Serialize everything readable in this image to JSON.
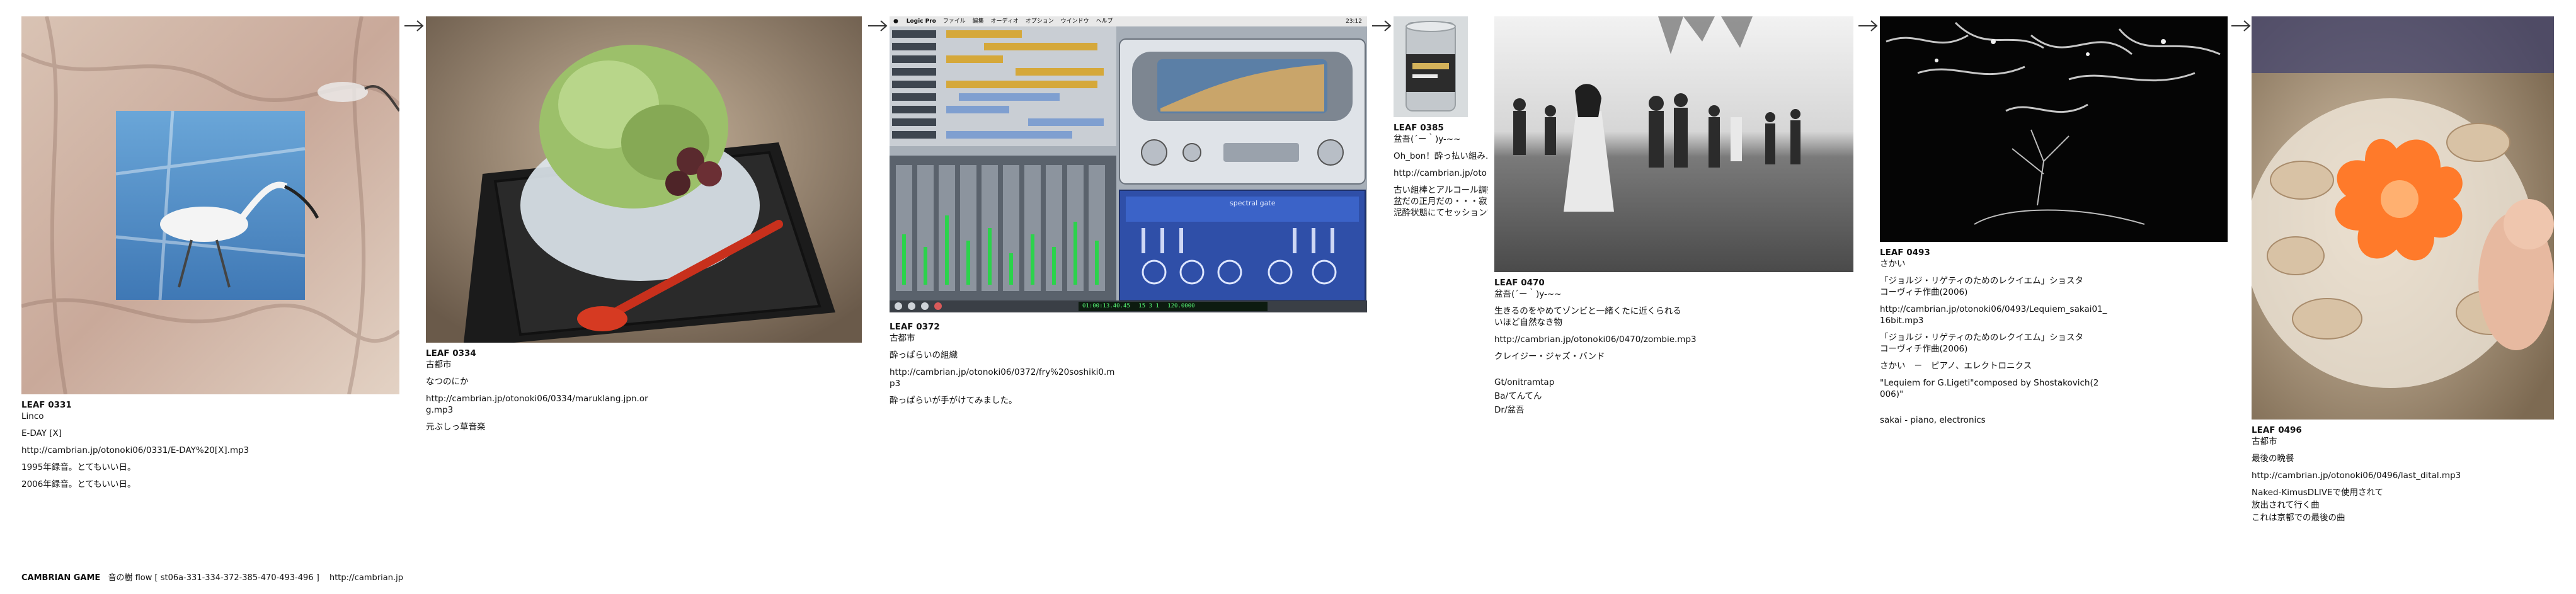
{
  "leaves": [
    {
      "id": "LEAF 0331",
      "lines": [
        "Linco",
        "E-DAY [X]",
        "http://cambrian.jp/otonoki06/0331/E-DAY%20[X].mp3",
        "1995年録音。とてもいい日。",
        "2006年録音。とてもいい日。"
      ]
    },
    {
      "id": "LEAF 0334",
      "lines": [
        "古都市",
        "なつのにか",
        "http://cambrian.jp/otonoki06/0334/maruklang.jpn.or",
        "g.mp3",
        "元ぶしっ草音楽"
      ]
    },
    {
      "id": "LEAF 0372",
      "lines": [
        "古都市",
        "酔っぱらいの組織",
        "http://cambrian.jp/otonoki06/0372/fry%20soshiki0.m",
        "p3",
        "酔っぱらいが手がけてみました。"
      ]
    },
    {
      "id": "LEAF 0385",
      "lines": [
        "盆吾(´ー｀)y-~~",
        "Oh_bon！酔っ払い組み…",
        "http://cambrian.jp/oto",
        "古い組棒とアルコール調整…",
        "盆だの正月だの・・・寂しくて",
        "泥酔状態にてセッションで…"
      ]
    },
    {
      "id": "LEAF 0470",
      "lines": [
        "盆吾(´ー｀)y-~~",
        "生きるのをやめてゾンビと一緒くたに近くられる",
        "いほど自然なき物",
        "http://cambrian.jp/otonoki06/0470/zombie.mp3",
        "クレイジー・ジャズ・バンド",
        "Gt/onitramtap",
        "Ba/てんてん",
        "Dr/盆吾"
      ]
    },
    {
      "id": "LEAF 0493",
      "lines": [
        "さかい",
        "「ジョルジ・リゲティのためのレクイエム」ショスタ",
        "コーヴィチ作曲(2006)",
        "http://cambrian.jp/otonoki06/0493/Lequiem_sakai01_",
        "16bit.mp3",
        "「ジョルジ・リゲティのためのレクイエム」ショスタ",
        "コーヴィチ作曲(2006)",
        "さかい　－　ピアノ、エレクトロニクス",
        "\"Lequiem for G.Ligeti\"composed by Shostakovich(2",
        "006)\"",
        "sakai - piano, electronics"
      ]
    },
    {
      "id": "LEAF 0496",
      "lines": [
        "古都市",
        "最後の晩餐",
        "http://cambrian.jp/otonoki06/0496/last_dital.mp3",
        "Naked-KimusDLIVEで使用されて",
        "放出されて行く曲",
        "これは京都での最後の曲"
      ]
    }
  ],
  "daw": {
    "menubar": [
      "Logic Pro",
      "ファイル",
      "編集",
      "オーディオ",
      "オプション",
      "ウインドウ",
      "ヘルプ"
    ],
    "clock": "23:12",
    "transport_time": "01:00:13.40.45",
    "bars": "15 3 1",
    "tempo": "120.0000",
    "plugin_name": "spectral gate"
  },
  "footer": {
    "title": "CAMBRIAN GAME",
    "flow_label": "音の樹 flow [ st06a-331-334-372-385-470-493-496 ]",
    "url": "http://cambrian.jp"
  }
}
